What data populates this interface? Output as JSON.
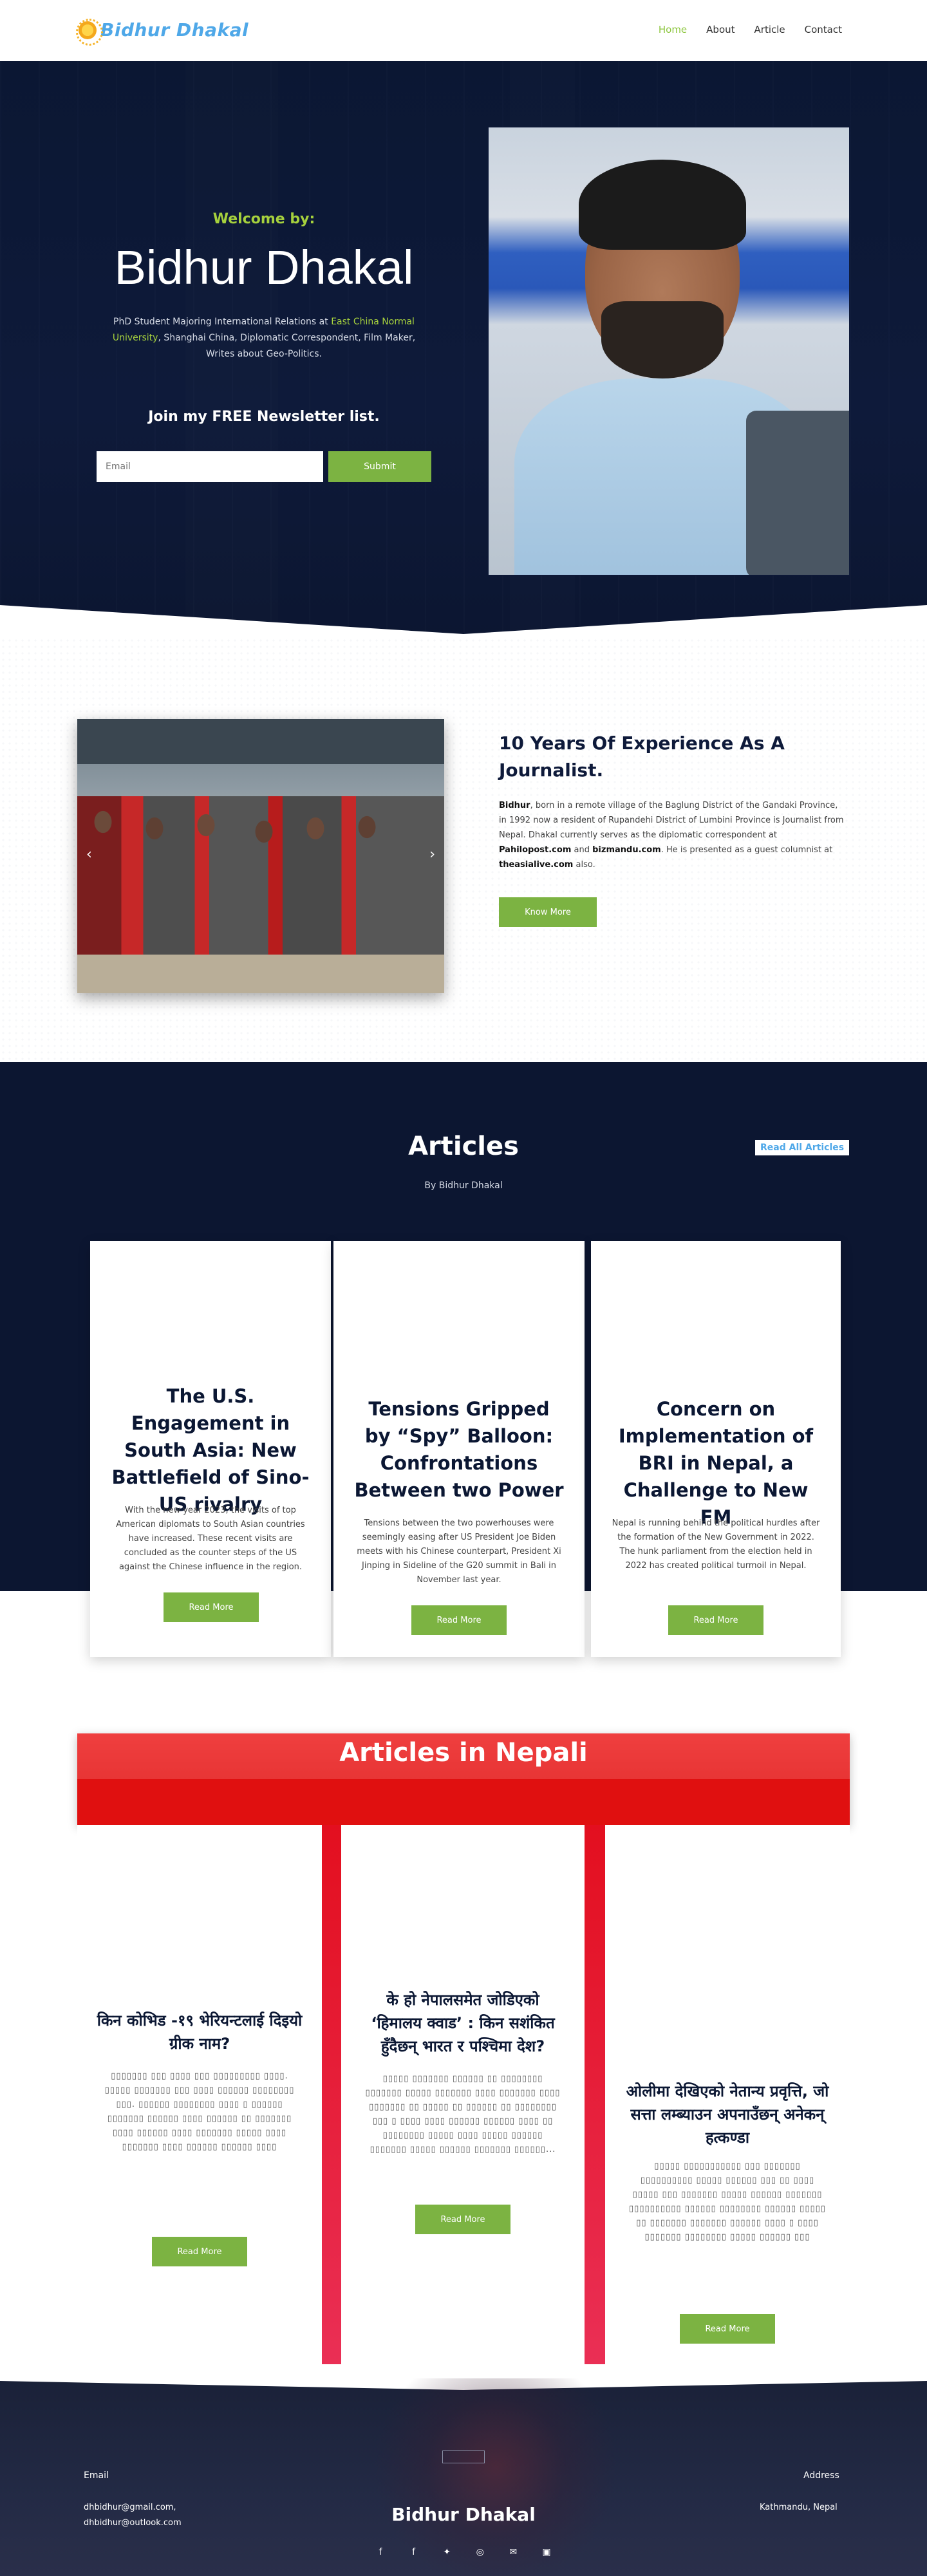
{
  "header": {
    "logo_text": "Bidhur Dhakal",
    "nav": [
      {
        "label": "Home",
        "active": true
      },
      {
        "label": "About",
        "active": false
      },
      {
        "label": "Article",
        "active": false
      },
      {
        "label": "Contact",
        "active": false
      }
    ]
  },
  "hero": {
    "welcome": "Welcome by:",
    "name": "Bidhur Dhakal",
    "desc_pre": "PhD Student Majoring International Relations at ",
    "desc_highlight": "East China Normal University",
    "desc_post": ", Shanghai China, Diplomatic Correspondent, Film Maker, Writes about Geo-Politics.",
    "newsletter_title": "Join my FREE Newsletter list.",
    "email_placeholder": "Email",
    "submit_label": "Submit"
  },
  "experience": {
    "title": "10 Years Of Experience As A Journalist.",
    "text": {
      "name": "Bidhur",
      "part1": ", born in a remote village of the Baglung District of the Gandaki Province, in 1992 now a resident of Rupandehi District of Lumbini Province is Journalist from Nepal. Dhakal currently serves as the diplomatic correspondent at ",
      "site1": "Pahilopost.com",
      "part2": " and ",
      "site2": "bizmandu.com",
      "part3": ". He is presented as a guest columnist at ",
      "site3": "theasialive.com",
      "part4": " also."
    },
    "button": "Know More",
    "prev_arrow": "‹",
    "next_arrow": "›"
  },
  "articles": {
    "title": "Articles",
    "subtitle": "By Bidhur Dhakal",
    "read_all": "Read All Articles",
    "cards": [
      {
        "title": "The U.S. Engagement in South Asia: New Battlefield of Sino-US rivalry",
        "text": "With the new year 2023, the visits of top American diplomats to South Asian countries have increased.  These recent visits are concluded as the counter steps of the US against the Chinese influence in the region.",
        "button": "Read More"
      },
      {
        "title": "Tensions Gripped by “Spy” Balloon: Confrontations Between two Power",
        "text": "Tensions between the two powerhouses were seemingly easing after US President Joe Biden meets with his Chinese counterpart, President Xi Jinping in Sideline of the G20 summit in Bali in November last year.",
        "button": "Read More"
      },
      {
        "title": "Concern on Implementation of BRI in Nepal, a Challenge to New FM",
        "text": "Nepal is running behind the political hurdles after the formation of the New Government in 2022. The hunk parliament from the election held in 2022 has created political turmoil in Nepal.",
        "button": "Read More"
      }
    ]
  },
  "nepali": {
    "title": "Articles in Nepali",
    "cards": [
      {
        "title": "किन कोभिड -१९ भेरियन्टलाई दिइयो ग्रीक नाम?",
        "text": "▯▯▯▯▯▯▯ ▯▯▯ ▯▯▯▯ ▯▯▯ ▯▯▯▯▯▯▯▯▯ ▯▯▯▯. ▯▯▯▯▯ ▯▯▯▯▯▯▯ ▯▯▯ ▯▯▯▯ ▯▯▯▯▯▯ ▯▯▯▯▯▯▯▯ ▯▯▯. ▯▯▯▯▯▯ ▯▯▯▯▯▯▯▯ ▯▯▯▯ ▯ ▯▯▯▯▯▯ ▯▯▯▯▯▯▯ ▯▯▯▯▯▯ ▯▯▯▯ ▯▯▯▯▯▯ ▯▯ ▯▯▯▯▯▯▯ ▯▯▯▯ ▯▯▯▯▯▯ ▯▯▯▯ ▯▯▯▯▯▯▯ ▯▯▯▯▯ ▯▯▯▯ ▯▯▯▯▯▯▯ ▯▯▯▯ ▯▯▯▯▯▯ ▯▯▯▯▯▯ ▯▯▯▯",
        "button": "Read More"
      },
      {
        "title": "के हो नेपालसमेत जोडिएको ‘हिमालय क्वाड’ : किन सशंकित हुँदैछन् भारत र पश्चिमा देश?",
        "text": "▯▯▯▯▯ ▯▯▯▯▯▯▯ ▯▯▯▯▯▯ ▯▯ ▯▯▯▯▯▯▯▯ ▯▯▯▯▯▯▯ ▯▯▯▯▯ ▯▯▯▯▯▯▯ ▯▯▯▯ ▯▯▯▯▯▯▯ ▯▯▯▯ ▯▯▯▯▯▯▯ ▯▯ ▯▯▯▯▯ ▯▯ ▯▯▯▯▯▯ ▯▯ ▯▯▯▯▯▯▯▯ ▯▯▯ ▯ ▯▯▯▯ ▯▯▯▯ ▯▯▯▯▯▯ ▯▯▯▯▯▯ ▯▯▯▯ ▯▯ ▯▯▯▯▯▯▯▯ ▯▯▯▯▯ ▯▯▯▯ ▯▯▯▯▯ ▯▯▯▯▯▯ ▯▯▯▯▯▯▯ ▯▯▯▯▯ ▯▯▯▯▯▯ ▯▯▯▯▯▯▯ ▯▯▯▯▯▯...",
        "button": "Read More"
      },
      {
        "title": "ओलीमा देखिएको नेतान्य प्रवृत्ति, जो सत्ता लम्ब्याउन अपनाउँछन् अनेकन् हत्कण्डा",
        "text": "▯▯▯▯▯ ▯▯▯▯▯▯▯▯▯▯▯ ▯▯▯ ▯▯▯▯▯▯▯ ▯▯▯▯▯▯▯▯▯▯ ▯▯▯▯▯ ▯▯▯▯▯▯ ▯▯▯ ▯▯ ▯▯▯▯ ▯▯▯▯▯ ▯▯▯ ▯▯▯▯▯▯▯ ▯▯▯▯▯ ▯▯▯▯▯▯ ▯▯▯▯▯▯▯ ▯▯▯▯▯▯▯▯▯▯ ▯▯▯▯▯▯ ▯▯▯▯▯▯▯▯ ▯▯▯▯▯▯ ▯▯▯▯▯ ▯▯ ▯▯▯▯▯▯▯ ▯▯▯▯▯▯▯ ▯▯▯▯▯▯ ▯▯▯▯ ▯ ▯▯▯▯ ▯▯▯▯▯▯▯ ▯▯▯▯▯▯▯▯ ▯▯▯▯▯ ▯▯▯▯▯▯ ▯▯▯",
        "button": "Read More"
      }
    ]
  },
  "footer": {
    "email_label": "Email",
    "email1": "dhbidhur@gmail.com,",
    "email2": "dhbidhur@outlook.com",
    "name": "Bidhur Dhakal",
    "address_label": "Address",
    "address": "Kathmandu, Nepal",
    "socials": [
      {
        "icon": "facebook-icon",
        "glyph": "f"
      },
      {
        "icon": "facebook-page-icon",
        "glyph": "f"
      },
      {
        "icon": "twitter-icon",
        "glyph": "✦"
      },
      {
        "icon": "instagram-icon",
        "glyph": "◎"
      },
      {
        "icon": "wechat-icon",
        "glyph": "✉"
      },
      {
        "icon": "linkedin-icon",
        "glyph": "▣"
      }
    ]
  },
  "colors": {
    "accent_green": "#7cb342",
    "navy": "#0c1631",
    "nepali_red": "#e01010",
    "logo_blue": "#4fa8e8"
  }
}
